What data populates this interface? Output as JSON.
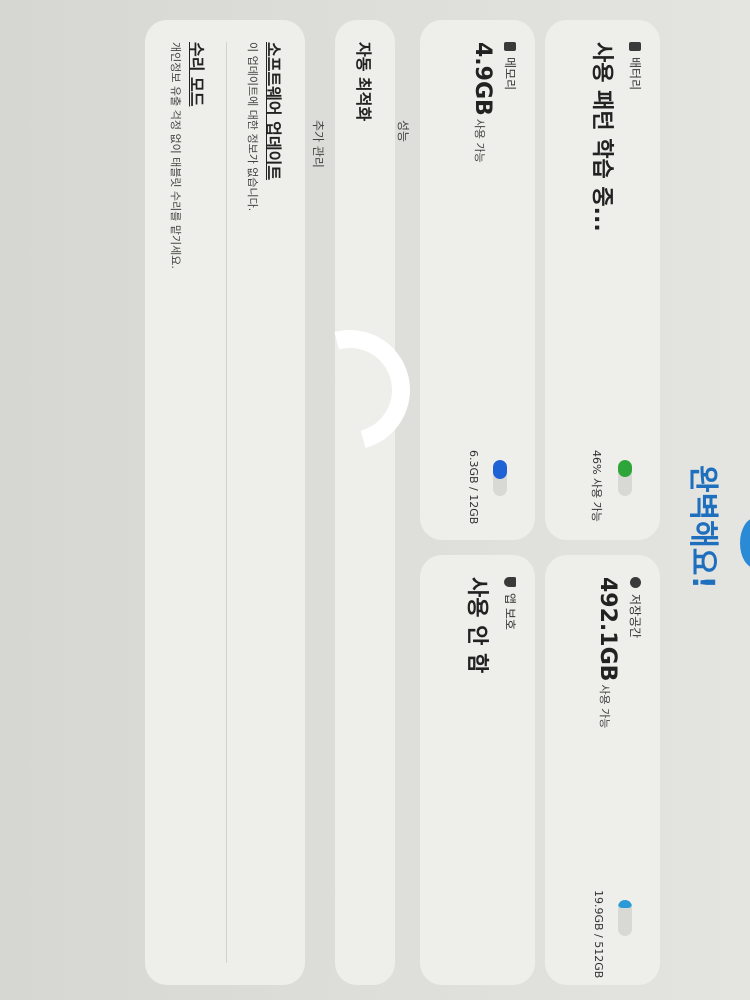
{
  "header": {
    "title": "완벽해요!"
  },
  "battery": {
    "label": "배터리",
    "status": "사용 패턴 학습 중...",
    "detail": "46% 사용 가능",
    "bar_fraction": 0.46,
    "bar_color": "#2ea53a"
  },
  "storage": {
    "label": "저장공간",
    "value": "492.1GB",
    "unit_text": "사용 가능",
    "detail": "19.9GB / 512GB",
    "bar_fraction": 0.04,
    "bar_color": "#2b9ad6"
  },
  "memory": {
    "label": "메모리",
    "value": "4.9GB",
    "unit_text": "사용 가능",
    "detail": "6.3GB / 12GB",
    "bar_fraction": 0.52,
    "bar_color": "#1f62d6"
  },
  "app_protection": {
    "label": "앱 보호",
    "value": "사용 안 함"
  },
  "performance": {
    "section_label": "성능",
    "auto_optimize": "자동 최적화"
  },
  "additional": {
    "section_label": "추가 관리",
    "software_update": {
      "title": "소프트웨어 업데이트",
      "subtitle": "이 업데이트에 대한 정보가 없습니다."
    },
    "repair_mode": {
      "title": "수리 모드",
      "subtitle": "개인정보 유출 걱정 없이 태블릿 수리를 맡기세요."
    }
  }
}
